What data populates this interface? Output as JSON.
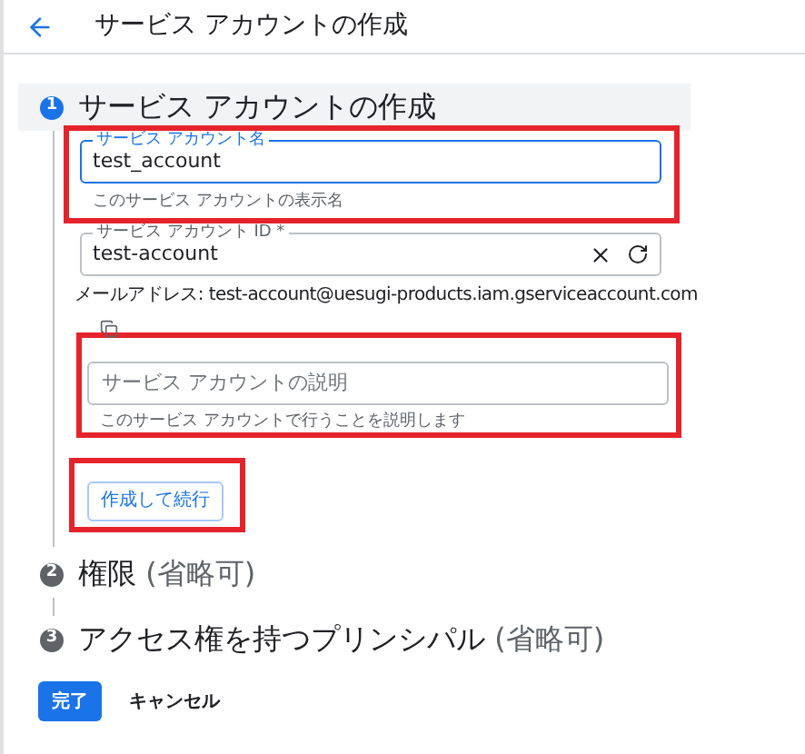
{
  "header": {
    "title": "サービス アカウントの作成"
  },
  "steps": [
    {
      "number": "1",
      "title": "サービス アカウントの作成",
      "active": true
    },
    {
      "number": "2",
      "title": "権限",
      "optional": "(省略可)",
      "active": false
    },
    {
      "number": "3",
      "title": "アクセス権を持つプリンシパル",
      "optional": "(省略可)",
      "active": false
    }
  ],
  "name_field": {
    "label": "サービス アカウント名",
    "value": "test_account",
    "helper": "このサービス アカウントの表示名",
    "focused": true,
    "highlighted": true
  },
  "id_field": {
    "label": "サービス アカウント ID *",
    "value": "test-account"
  },
  "email": {
    "label": "メールアドレス:",
    "value": "test-account@uesugi-products.iam.gserviceaccount.com"
  },
  "description_field": {
    "placeholder": "サービス アカウントの説明",
    "helper": "このサービス アカウントで行うことを説明します",
    "highlighted": true
  },
  "continue_button": {
    "label": "作成して続行",
    "highlighted": true
  },
  "footer": {
    "done": "完了",
    "cancel": "キャンセル"
  }
}
